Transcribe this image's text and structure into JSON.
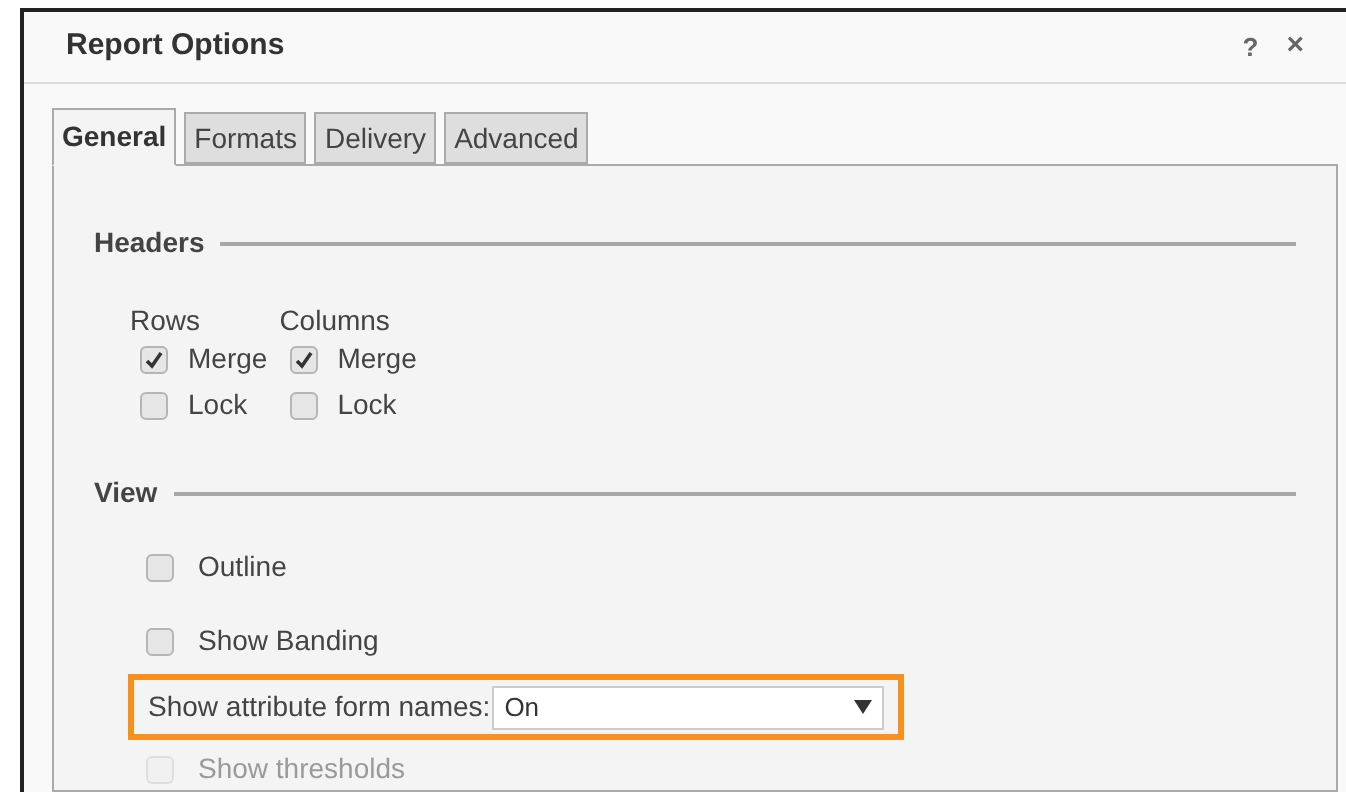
{
  "window": {
    "title": "Report Options",
    "help": "?",
    "close": "×"
  },
  "tabs": [
    {
      "label": "General",
      "selected": true
    },
    {
      "label": "Formats",
      "selected": false
    },
    {
      "label": "Delivery",
      "selected": false
    },
    {
      "label": "Advanced",
      "selected": false
    }
  ],
  "headers": {
    "title": "Headers",
    "columns": [
      {
        "label": "Rows",
        "options": [
          {
            "label": "Merge",
            "checked": true
          },
          {
            "label": "Lock",
            "checked": false
          }
        ]
      },
      {
        "label": "Columns",
        "options": [
          {
            "label": "Merge",
            "checked": true
          },
          {
            "label": "Lock",
            "checked": false
          }
        ]
      }
    ]
  },
  "view": {
    "title": "View",
    "options": [
      {
        "label": "Outline",
        "checked": false,
        "disabled": false
      },
      {
        "label": "Show Banding",
        "checked": false,
        "disabled": false
      }
    ],
    "attribute_form_names": {
      "label": "Show attribute form names:",
      "value": "On",
      "highlighted": true
    },
    "more_options": [
      {
        "label": "Show thresholds",
        "checked": false,
        "disabled": true
      }
    ]
  }
}
